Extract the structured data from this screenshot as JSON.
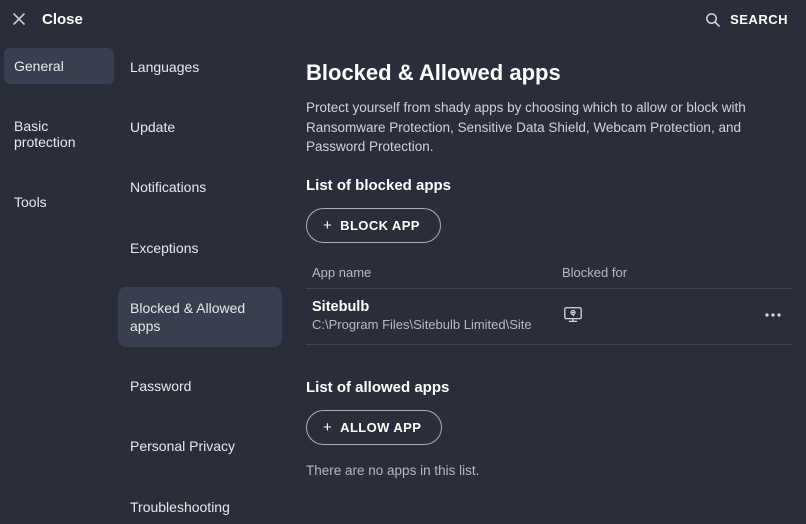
{
  "header": {
    "close_label": "Close",
    "search_label": "SEARCH"
  },
  "sidebar1": {
    "items": [
      {
        "label": "General",
        "active": true
      },
      {
        "label": "Basic protection",
        "active": false
      },
      {
        "label": "Tools",
        "active": false
      }
    ]
  },
  "sidebar2": {
    "items": [
      {
        "label": "Languages",
        "active": false
      },
      {
        "label": "Update",
        "active": false
      },
      {
        "label": "Notifications",
        "active": false
      },
      {
        "label": "Exceptions",
        "active": false
      },
      {
        "label": "Blocked & Allowed apps",
        "active": true
      },
      {
        "label": "Password",
        "active": false
      },
      {
        "label": "Personal Privacy",
        "active": false
      },
      {
        "label": "Troubleshooting",
        "active": false
      }
    ]
  },
  "main": {
    "title": "Blocked & Allowed apps",
    "description": "Protect yourself from shady apps by choosing which to allow or block with Ransomware Protection, Sensitive Data Shield, Webcam Protection, and Password Protection.",
    "blocked": {
      "section_title": "List of blocked apps",
      "button_label": "BLOCK APP",
      "columns": {
        "name": "App name",
        "blocked_for": "Blocked for"
      },
      "rows": [
        {
          "name": "Sitebulb",
          "path": "C:\\Program Files\\Sitebulb Limited\\Site",
          "blocked_for_icon": "ransomware-shield-icon"
        }
      ]
    },
    "allowed": {
      "section_title": "List of allowed apps",
      "button_label": "ALLOW APP",
      "empty_message": "There are no apps in this list."
    }
  }
}
